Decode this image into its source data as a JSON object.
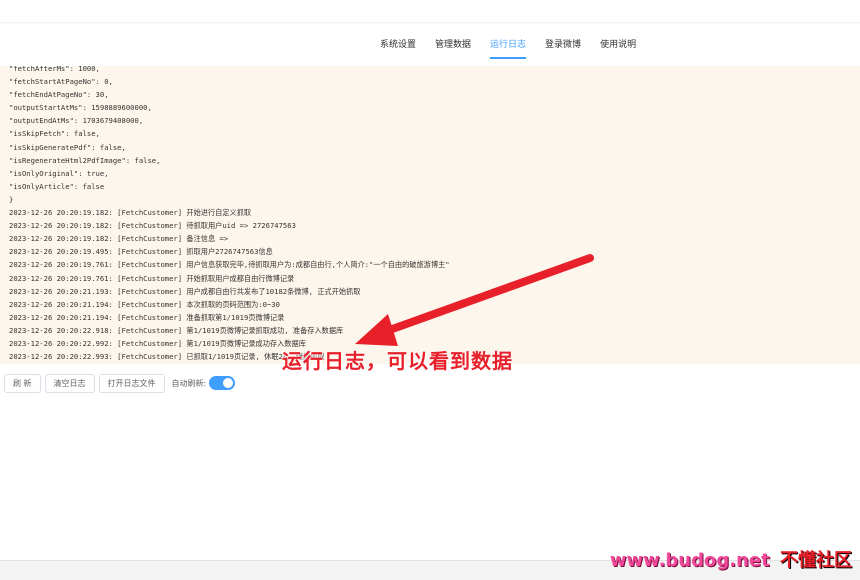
{
  "tabs": [
    {
      "label": "系统设置",
      "active": false
    },
    {
      "label": "管理数据",
      "active": false
    },
    {
      "label": "运行日志",
      "active": true
    },
    {
      "label": "登录微博",
      "active": false
    },
    {
      "label": "使用说明",
      "active": false
    }
  ],
  "log_lines": [
    "\"fetchAfterMs\": 1000,",
    "\"fetchStartAtPageNo\": 0,",
    "\"fetchEndAtPageNo\": 30,",
    "\"outputStartAtMs\": 1598889600000,",
    "\"outputEndAtMs\": 1703679408000,",
    "\"isSkipFetch\": false,",
    "\"isSkipGeneratePdf\": false,",
    "\"isRegenerateHtml2PdfImage\": false,",
    "\"isOnlyOriginal\": true,",
    "\"isOnlyArticle\": false",
    "}",
    "2023-12-26 20:20:19.182: [FetchCustomer] 开始进行自定义抓取",
    "2023-12-26 20:20:19.182: [FetchCustomer] 待抓取用户uid => 2726747563",
    "2023-12-26 20:20:19.182: [FetchCustomer] 备注信息 =>",
    "2023-12-26 20:20:19.495: [FetchCustomer] 抓取用户2726747563信息",
    "2023-12-26 20:20:19.761: [FetchCustomer] 用户信息获取完毕,待抓取用户为:成都自由行,个人简介:\"一个自由的破旅游博主\"",
    "2023-12-26 20:20:19.761: [FetchCustomer] 开始抓取用户成都自由行微博记录",
    "2023-12-26 20:20:21.193: [FetchCustomer] 用户成都自由行共发布了10182条微博, 正式开始抓取",
    "2023-12-26 20:20:21.194: [FetchCustomer] 本次抓取的页码范围为:0~30",
    "2023-12-26 20:20:21.194: [FetchCustomer] 准备抓取第1/1019页微博记录",
    "2023-12-26 20:20:22.918: [FetchCustomer] 第1/1019页微博记录抓取成功, 准备存入数据库",
    "2023-12-26 20:20:22.992: [FetchCustomer] 第1/1019页微博记录成功存入数据库",
    "2023-12-26 20:20:22.993: [FetchCustomer] 已抓取1/1019页记录, 休眠2s, 继续抓取"
  ],
  "controls": {
    "refresh_label": "刷 新",
    "clear_label": "清空日志",
    "open_file_label": "打开日志文件",
    "auto_refresh_label": "自动刷新:",
    "auto_refresh_on": true
  },
  "annotation": {
    "text": "运行日志，可以看到数据",
    "color": "#e8202a"
  },
  "watermark": {
    "url": "www.budog.net",
    "site": "不懂社区"
  },
  "colors": {
    "accent": "#409eff",
    "log_bg": "#fdf6ec",
    "annotation": "#e8202a"
  }
}
